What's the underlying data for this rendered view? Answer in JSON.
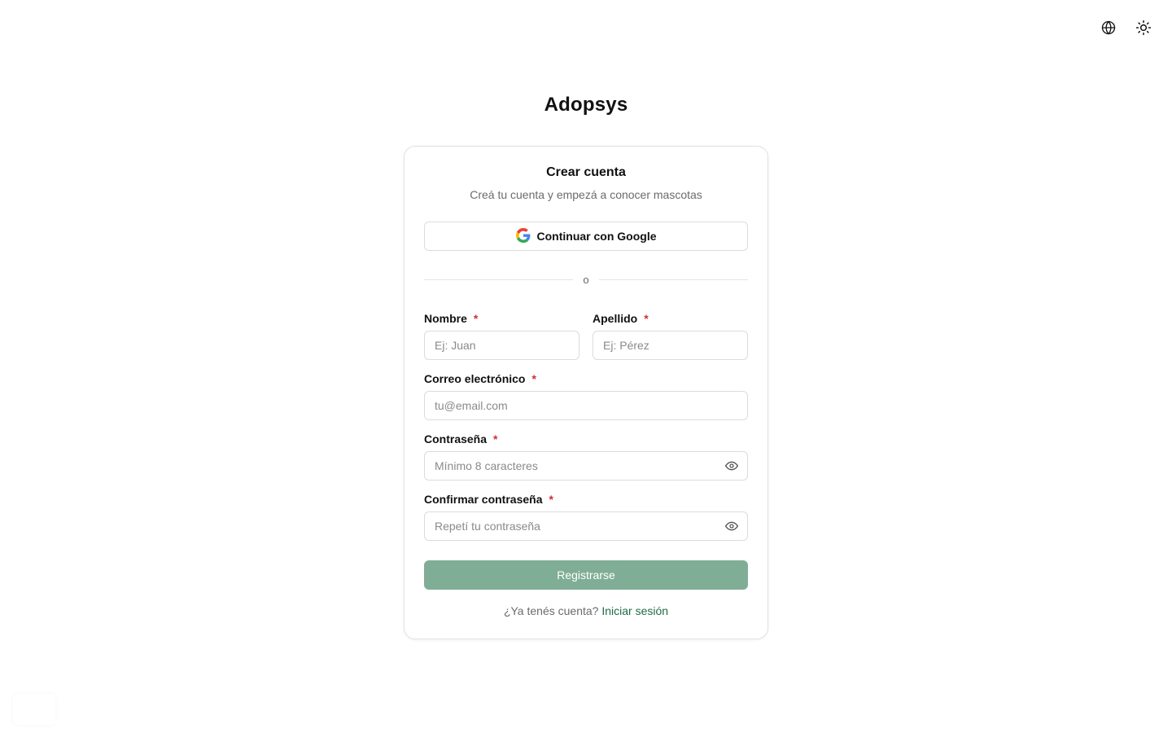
{
  "brand": {
    "name": "Adopsys"
  },
  "topbar": {
    "language_icon": "globe-icon",
    "theme_icon": "sun-icon"
  },
  "card": {
    "title": "Crear cuenta",
    "subtitle": "Creá tu cuenta y empezá a conocer mascotas",
    "google_button": "Continuar con Google",
    "divider": "o"
  },
  "form": {
    "first_name": {
      "label": "Nombre",
      "placeholder": "Ej: Juan",
      "required": "*"
    },
    "last_name": {
      "label": "Apellido",
      "placeholder": "Ej: Pérez",
      "required": "*"
    },
    "email": {
      "label": "Correo electrónico",
      "placeholder": "tu@email.com",
      "required": "*"
    },
    "password": {
      "label": "Contraseña",
      "placeholder": "Mínimo 8 caracteres",
      "required": "*"
    },
    "confirm_password": {
      "label": "Confirmar contraseña",
      "placeholder": "Repetí tu contraseña",
      "required": "*"
    },
    "submit": "Registrarse"
  },
  "footer": {
    "text": "¿Ya tenés cuenta?",
    "link": "Iniciar sesión"
  },
  "colors": {
    "primary": "#80ad96",
    "link": "#1f6b44",
    "required": "#d32f2f"
  }
}
